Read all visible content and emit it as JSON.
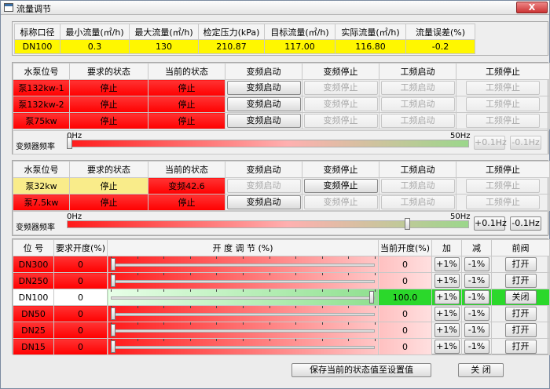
{
  "window": {
    "title": "流量调节",
    "close_label": "X"
  },
  "flow_table": {
    "headers": [
      "标称口径",
      "最小流量(㎡/h)",
      "最大流量(㎡/h)",
      "检定压力(kPa)",
      "目标流量(㎡/h)",
      "实际流量(㎡/h)",
      "流量误差(%)"
    ],
    "values": [
      "DN100",
      "0.3",
      "130",
      "210.87",
      "117.00",
      "116.80",
      "-0.2"
    ]
  },
  "pump_group_1": {
    "headers": [
      "水泵位号",
      "要求的状态",
      "当前的状态",
      "变频启动",
      "变频停止",
      "工频启动",
      "工频停止"
    ],
    "rows": [
      {
        "name": "泵132kw-1",
        "required": "停止",
        "current": "停止",
        "vf_start": "变频启动",
        "vf_stop": "变频停止",
        "pf_start": "工频启动",
        "pf_stop": "工频停止"
      },
      {
        "name": "泵132kw-2",
        "required": "停止",
        "current": "停止",
        "vf_start": "变频启动",
        "vf_stop": "变频停止",
        "pf_start": "工频启动",
        "pf_stop": "工频停止"
      },
      {
        "name": "泵75kw",
        "required": "停止",
        "current": "停止",
        "vf_start": "变频启动",
        "vf_stop": "变频停止",
        "pf_start": "工频启动",
        "pf_stop": "工频停止"
      }
    ],
    "slider": {
      "label": "变频器频率",
      "min_label": "0Hz",
      "max_label": "50Hz",
      "value_fraction": 0.0,
      "plus": "+0.1Hz",
      "minus": "-0.1Hz"
    }
  },
  "pump_group_2": {
    "headers": [
      "水泵位号",
      "要求的状态",
      "当前的状态",
      "变频启动",
      "变频停止",
      "工频启动",
      "工频停止"
    ],
    "rows": [
      {
        "name": "泵32kw",
        "required": "停止",
        "current": "变频42.6",
        "vf_start": "变频启动",
        "vf_stop": "变频停止",
        "pf_start": "工频启动",
        "pf_stop": "工频停止"
      },
      {
        "name": "泵7.5kw",
        "required": "停止",
        "current": "停止",
        "vf_start": "变频启动",
        "vf_stop": "变频停止",
        "pf_start": "工频启动",
        "pf_stop": "工频停止"
      }
    ],
    "slider": {
      "label": "变频器频率",
      "min_label": "0Hz",
      "max_label": "50Hz",
      "value_fraction": 0.852,
      "plus": "+0.1Hz",
      "minus": "-0.1Hz"
    }
  },
  "valves": {
    "headers": [
      "位 号",
      "要求开度(%)",
      "开  度  调  节   (%)",
      "当前开度(%)",
      "加",
      "减",
      "前阀"
    ],
    "rows": [
      {
        "name": "DN300",
        "required": "0",
        "fraction": 0.0,
        "current": "0",
        "plus": "+1%",
        "minus": "-1%",
        "action": "打开",
        "active": false
      },
      {
        "name": "DN250",
        "required": "0",
        "fraction": 0.0,
        "current": "0",
        "plus": "+1%",
        "minus": "-1%",
        "action": "打开",
        "active": false
      },
      {
        "name": "DN100",
        "required": "0",
        "fraction": 1.0,
        "current": "100.0",
        "plus": "+1%",
        "minus": "-1%",
        "action": "关闭",
        "active": true
      },
      {
        "name": "DN50",
        "required": "0",
        "fraction": 0.0,
        "current": "0",
        "plus": "+1%",
        "minus": "-1%",
        "action": "打开",
        "active": false
      },
      {
        "name": "DN25",
        "required": "0",
        "fraction": 0.0,
        "current": "0",
        "plus": "+1%",
        "minus": "-1%",
        "action": "打开",
        "active": false
      },
      {
        "name": "DN15",
        "required": "0",
        "fraction": 0.0,
        "current": "0",
        "plus": "+1%",
        "minus": "-1%",
        "action": "打开",
        "active": false
      }
    ]
  },
  "footer": {
    "save_label": "保存当前的状态值至设置值",
    "close_label": "关 闭"
  }
}
